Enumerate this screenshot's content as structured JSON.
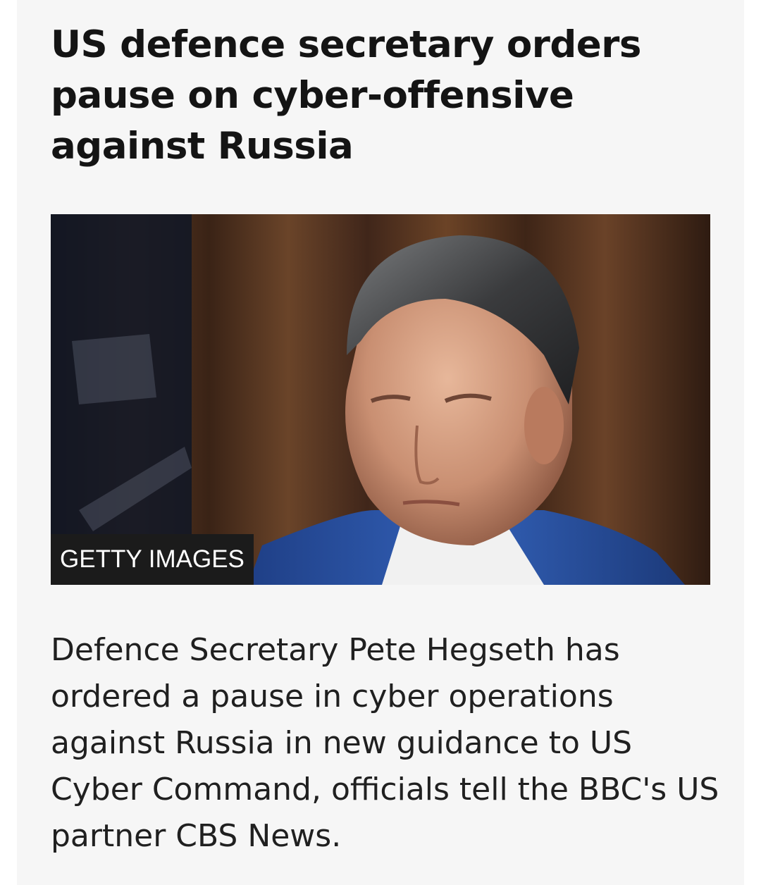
{
  "article": {
    "headline": "US defence secretary orders pause on cyber-offensive against Russia",
    "image": {
      "credit": "GETTY IMAGES",
      "subject": "man in blue suit with slicked-back hair, curtained background"
    },
    "summary": "Defence Secretary Pete Hegseth has ordered a pause in cyber operations against Russia in new guidance to US Cyber Command, officials tell the BBC's US partner CBS News."
  },
  "colors": {
    "card_background": "#f6f6f6",
    "headline_text": "#141414",
    "body_text": "#202020",
    "credit_background": "#1b1b1b",
    "credit_text": "#ffffff"
  }
}
